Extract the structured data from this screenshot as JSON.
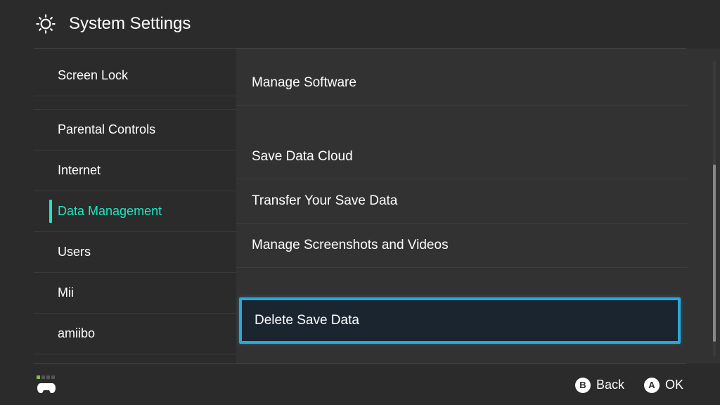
{
  "header": {
    "title": "System Settings"
  },
  "sidebar": {
    "items": [
      {
        "label": "Screen Lock",
        "selected": false
      },
      {
        "label": "Parental Controls",
        "selected": false
      },
      {
        "label": "Internet",
        "selected": false
      },
      {
        "label": "Data Management",
        "selected": true
      },
      {
        "label": "Users",
        "selected": false
      },
      {
        "label": "Mii",
        "selected": false
      },
      {
        "label": "amiibo",
        "selected": false
      }
    ]
  },
  "main": {
    "options": [
      {
        "label": "Manage Software",
        "highlighted": false
      },
      {
        "label": "Save Data Cloud",
        "highlighted": false
      },
      {
        "label": "Transfer Your Save Data",
        "highlighted": false
      },
      {
        "label": "Manage Screenshots and Videos",
        "highlighted": false
      },
      {
        "label": "Delete Save Data",
        "highlighted": true
      }
    ]
  },
  "footer": {
    "back": {
      "letter": "B",
      "label": "Back"
    },
    "ok": {
      "letter": "A",
      "label": "OK"
    }
  }
}
